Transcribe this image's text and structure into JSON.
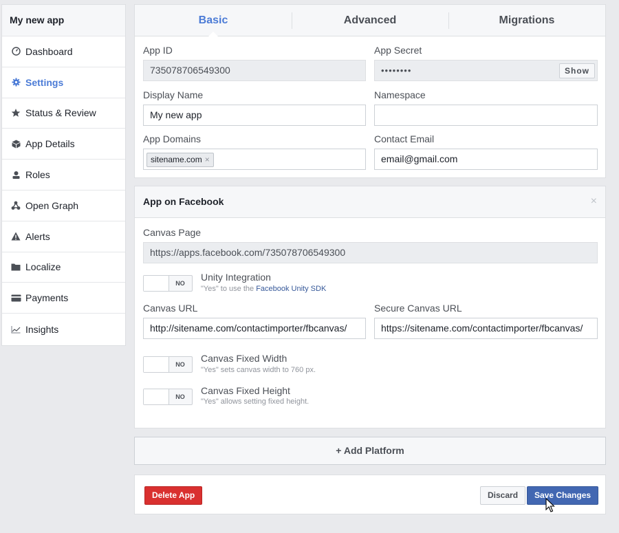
{
  "sidebar": {
    "title": "My new app",
    "items": [
      {
        "label": "Dashboard",
        "icon": "dashboard-icon"
      },
      {
        "label": "Settings",
        "icon": "gear-icon"
      },
      {
        "label": "Status & Review",
        "icon": "star-icon"
      },
      {
        "label": "App Details",
        "icon": "cube-icon"
      },
      {
        "label": "Roles",
        "icon": "person-icon"
      },
      {
        "label": "Open Graph",
        "icon": "graph-nodes-icon"
      },
      {
        "label": "Alerts",
        "icon": "warning-icon"
      },
      {
        "label": "Localize",
        "icon": "folder-icon"
      },
      {
        "label": "Payments",
        "icon": "card-icon"
      },
      {
        "label": "Insights",
        "icon": "chart-line-icon"
      }
    ],
    "active_index": 1
  },
  "tabs": [
    "Basic",
    "Advanced",
    "Migrations"
  ],
  "basic": {
    "app_id_label": "App ID",
    "app_id_value": "735078706549300",
    "app_secret_label": "App Secret",
    "app_secret_value": "••••••••",
    "show_label": "Show",
    "display_name_label": "Display Name",
    "display_name_value": "My new app",
    "namespace_label": "Namespace",
    "namespace_value": "",
    "app_domains_label": "App Domains",
    "app_domain_tag": "sitename.com",
    "tag_remove": "×",
    "contact_email_label": "Contact Email",
    "contact_email_value": "email@gmail.com"
  },
  "facebook": {
    "header": "App on Facebook",
    "close": "×",
    "canvas_page_label": "Canvas Page",
    "canvas_page_value": "https://apps.facebook.com/735078706549300",
    "unity_title": "Unity Integration",
    "unity_desc_prefix": "\"Yes\" to use the ",
    "unity_desc_link": "Facebook Unity SDK",
    "toggle_no": "NO",
    "canvas_url_label": "Canvas URL",
    "canvas_url_value": "http://sitename.com/contactimporter/fbcanvas/",
    "secure_canvas_url_label": "Secure Canvas URL",
    "secure_canvas_url_value": "https://sitename.com/contactimporter/fbcanvas/",
    "fixed_width_title": "Canvas Fixed Width",
    "fixed_width_desc": "\"Yes\" sets canvas width to 760 px.",
    "fixed_height_title": "Canvas Fixed Height",
    "fixed_height_desc": "\"Yes\" allows setting fixed height."
  },
  "add_platform": "+ Add Platform",
  "footer": {
    "delete": "Delete App",
    "discard": "Discard",
    "save": "Save Changes"
  },
  "colors": {
    "accent": "#4b7bd6",
    "delete": "#d9302f",
    "save": "#4267b2"
  }
}
